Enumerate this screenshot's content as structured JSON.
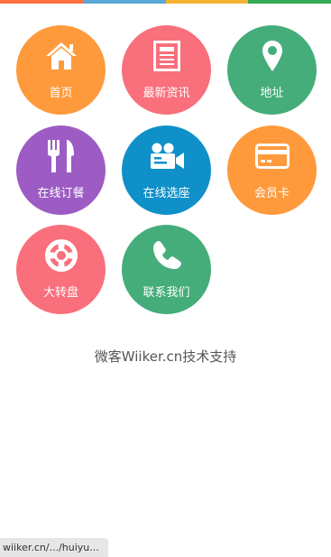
{
  "top_bar_colors": [
    "#ff7043",
    "#5ba6d6",
    "#f5b335",
    "#33aa55"
  ],
  "tiles": [
    {
      "label": "首页",
      "icon": "home-icon",
      "color": "#ff9a3c"
    },
    {
      "label": "最新资讯",
      "icon": "news-icon",
      "color": "#f96f7c"
    },
    {
      "label": "地址",
      "icon": "location-pin-icon",
      "color": "#45ad7a"
    },
    {
      "label": "在线订餐",
      "icon": "fork-knife-icon",
      "color": "#9c5cc4"
    },
    {
      "label": "在线选座",
      "icon": "video-camera-icon",
      "color": "#0f90c9"
    },
    {
      "label": "会员卡",
      "icon": "card-icon",
      "color": "#ff9a3c"
    },
    {
      "label": "大转盘",
      "icon": "lifebuoy-icon",
      "color": "#f96f7c"
    },
    {
      "label": "联系我们",
      "icon": "phone-icon",
      "color": "#45ad7a"
    }
  ],
  "footer": {
    "support_text": "微客Wiiker.cn技术支持"
  },
  "status_url": "wiiker.cn/.../huiyu..."
}
